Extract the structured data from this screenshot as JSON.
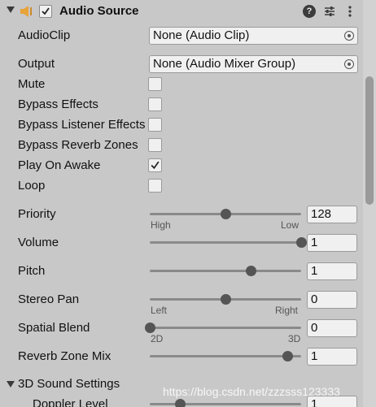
{
  "header": {
    "title": "Audio Source",
    "enabled": true,
    "icons": [
      "speaker-icon",
      "help-icon",
      "presets-icon",
      "more-menu-icon"
    ]
  },
  "fields": {
    "audio_clip": {
      "label": "AudioClip",
      "value": "None (Audio Clip)"
    },
    "output": {
      "label": "Output",
      "value": "None (Audio Mixer Group)"
    }
  },
  "toggles": [
    {
      "label": "Mute",
      "checked": false
    },
    {
      "label": "Bypass Effects",
      "checked": false
    },
    {
      "label": "Bypass Listener Effects",
      "checked": false
    },
    {
      "label": "Bypass Reverb Zones",
      "checked": false
    },
    {
      "label": "Play On Awake",
      "checked": true
    },
    {
      "label": "Loop",
      "checked": false
    }
  ],
  "sliders": {
    "priority": {
      "label": "Priority",
      "value": "128",
      "fraction": 0.5,
      "left_label": "High",
      "right_label": "Low"
    },
    "volume": {
      "label": "Volume",
      "value": "1",
      "fraction": 1.0
    },
    "pitch": {
      "label": "Pitch",
      "value": "1",
      "fraction": 0.667
    },
    "stereo_pan": {
      "label": "Stereo Pan",
      "value": "0",
      "fraction": 0.5,
      "left_label": "Left",
      "right_label": "Right"
    },
    "spatial_blend": {
      "label": "Spatial Blend",
      "value": "0",
      "fraction": 0.0,
      "left_label": "2D",
      "right_label": "3D"
    },
    "reverb_zone_mix": {
      "label": "Reverb Zone Mix",
      "value": "1",
      "fraction": 0.91
    },
    "doppler_level": {
      "label": "Doppler Level",
      "value": "1",
      "fraction": 0.2
    }
  },
  "section": {
    "label": "3D Sound Settings"
  },
  "watermark": "https://blog.csdn.net/zzzsss123333",
  "colors": {
    "background": "#c8c8c8",
    "field": "#f0f0f0",
    "speaker": "#e8a33a"
  }
}
